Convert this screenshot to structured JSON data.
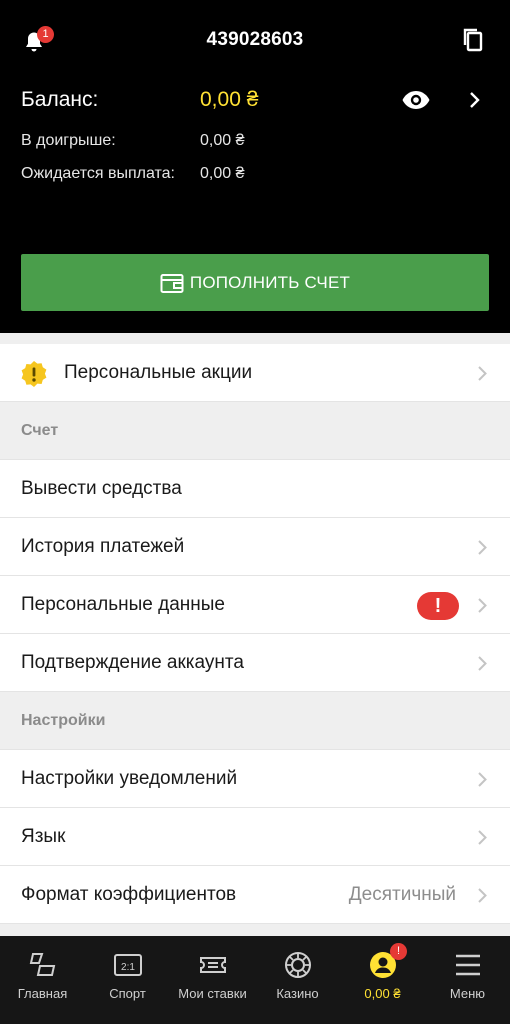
{
  "header": {
    "account_id": "439028603",
    "notifications_count": "1",
    "balance_label": "Баланс:",
    "balance_value": "0,00 ₴",
    "in_play_label": "В доигрыше:",
    "in_play_value": "0,00 ₴",
    "pending_label": "Ожидается выплата:",
    "pending_value": "0,00 ₴",
    "deposit_label": "ПОПОЛНИТЬ СЧЕТ"
  },
  "list": {
    "promo_label": "Персональные акции",
    "section_account": "Счет",
    "withdraw": "Вывести средства",
    "payment_history": "История платежей",
    "personal_data": "Персональные данные",
    "personal_data_alert": "!",
    "verification": "Подтверждение аккаунта",
    "section_settings": "Настройки",
    "notification_settings": "Настройки уведомлений",
    "language": "Язык",
    "odds_format": "Формат коэффициентов",
    "odds_format_value": "Десятичный"
  },
  "nav": {
    "items": [
      {
        "label": "Главная",
        "icon": "home-icon"
      },
      {
        "label": "Спорт",
        "icon": "scoreboard-icon"
      },
      {
        "label": "Мои ставки",
        "icon": "ticket-icon"
      },
      {
        "label": "Казино",
        "icon": "casino-chip-icon"
      },
      {
        "label": "0,00 ₴",
        "icon": "profile-icon",
        "badge": "!"
      },
      {
        "label": "Меню",
        "icon": "menu-icon"
      }
    ]
  },
  "colors": {
    "accent_yellow": "#ffe134",
    "deposit_green": "#4a9e4b",
    "alert_red": "#e53935"
  }
}
